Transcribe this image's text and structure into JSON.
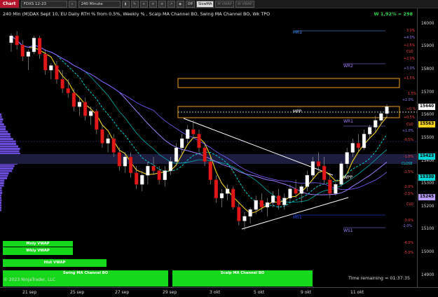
{
  "toolbar": {
    "chart_label": "Chart",
    "instrument": "FDXS 12-23",
    "period": "240 Minute",
    "indicators": [
      {
        "label": "Off",
        "active": false
      },
      {
        "label": "SlowMA",
        "active": true
      },
      {
        "label": "M VWAP",
        "active": false
      },
      {
        "label": "W VWAP",
        "active": false
      }
    ]
  },
  "chart": {
    "title": "240 Min (M)DAX Sept 10, EU Daily RTH % from 0.5%, Weekly % , Scalp MA Channel BO, Swing MA Channel BO, Wk TPO",
    "weekly_stat": "W 1,92% = 298",
    "copyright": "© 2023 NinjaTrader, LLC",
    "time_remaining": "Time remaining = 01:37:35",
    "buttons": {
      "monthly_vwap": "Mnly VWAP",
      "weekly_vwap": "Wkly VWAP",
      "hist_vwap": "Hist VWAP",
      "swing_ma": "Swing MA Channel BO",
      "scalp_ma": "Scalp MA Channel BO"
    },
    "levels": {
      "mr1": "MR1",
      "wr2": "WR2",
      "wr1": "WR1",
      "mpp": "MPP",
      "wpp": "WPP",
      "ws1": "WS1",
      "ms1": "MS1"
    },
    "right_labels": {
      "p30": "3.0%",
      "p40": "+4.0%",
      "p25": "+2.5%",
      "clo1": "CLO",
      "p20": "+2.0%",
      "p15": "+1.5%",
      "p30b": "+3.0%",
      "p15b": "+1.5%",
      "wb1": "1.5%",
      "p20b": "+2.0%",
      "p0": "+0.%",
      "p05": "+0.5%",
      "clo2": "CLO",
      "p10": "+1.0%",
      "m05": "-0.5%",
      "m10": "-1.0%",
      "close": "CLOSE",
      "m15": "-1.5%",
      "m20": "-2.0%",
      "m25": "-2.5%",
      "clo3": "CLO",
      "m30": "-3.0%",
      "m20b": "-2.0%",
      "m40": "-4.0%",
      "m50": "-5.0%"
    },
    "price_axis": [
      "16000",
      "15900",
      "15800",
      "15700",
      "15600",
      "15500",
      "15400",
      "15300",
      "15200",
      "15100",
      "15000",
      "14900"
    ],
    "price_tags": [
      {
        "value": "15640",
        "color": "#ffffff"
      },
      {
        "value": "15563",
        "color": "#f2d21a"
      },
      {
        "value": "15423",
        "color": "#00d4d4"
      },
      {
        "value": "15330",
        "color": "#00d4d4"
      },
      {
        "value": "15245",
        "color": "#b89cff"
      }
    ],
    "time_axis": [
      "21 sep",
      "25 sep",
      "27 sep",
      "29 sep",
      "3 okt",
      "5 okt",
      "9 okt",
      "11 okt"
    ]
  },
  "chart_data": {
    "type": "candlestick",
    "ylim": [
      14850,
      16070
    ],
    "candles": [
      [
        15920,
        15960,
        15880,
        15950
      ],
      [
        15950,
        15970,
        15890,
        15910
      ],
      [
        15910,
        15930,
        15840,
        15860
      ],
      [
        15860,
        15890,
        15800,
        15880
      ],
      [
        15880,
        15950,
        15870,
        15940
      ],
      [
        15940,
        15950,
        15850,
        15870
      ],
      [
        15870,
        15890,
        15780,
        15800
      ],
      [
        15800,
        15830,
        15760,
        15820
      ],
      [
        15820,
        15840,
        15740,
        15760
      ],
      [
        15760,
        15800,
        15700,
        15720
      ],
      [
        15720,
        15760,
        15680,
        15700
      ],
      [
        15700,
        15720,
        15620,
        15640
      ],
      [
        15640,
        15680,
        15600,
        15660
      ],
      [
        15660,
        15680,
        15580,
        15600
      ],
      [
        15600,
        15640,
        15560,
        15620
      ],
      [
        15620,
        15630,
        15520,
        15540
      ],
      [
        15540,
        15560,
        15460,
        15480
      ],
      [
        15480,
        15520,
        15440,
        15500
      ],
      [
        15500,
        15520,
        15420,
        15440
      ],
      [
        15440,
        15460,
        15360,
        15380
      ],
      [
        15380,
        15440,
        15350,
        15420
      ],
      [
        15420,
        15440,
        15330,
        15350
      ],
      [
        15350,
        15380,
        15280,
        15300
      ],
      [
        15300,
        15360,
        15270,
        15340
      ],
      [
        15340,
        15400,
        15300,
        15380
      ],
      [
        15380,
        15420,
        15340,
        15360
      ],
      [
        15360,
        15380,
        15300,
        15320
      ],
      [
        15320,
        15380,
        15290,
        15360
      ],
      [
        15360,
        15420,
        15340,
        15400
      ],
      [
        15400,
        15480,
        15380,
        15460
      ],
      [
        15460,
        15520,
        15430,
        15500
      ],
      [
        15500,
        15560,
        15480,
        15540
      ],
      [
        15540,
        15580,
        15500,
        15520
      ],
      [
        15520,
        15540,
        15440,
        15460
      ],
      [
        15460,
        15480,
        15380,
        15400
      ],
      [
        15400,
        15420,
        15300,
        15320
      ],
      [
        15320,
        15340,
        15220,
        15240
      ],
      [
        15240,
        15280,
        15200,
        15260
      ],
      [
        15260,
        15300,
        15230,
        15280
      ],
      [
        15280,
        15290,
        15190,
        15200
      ],
      [
        15200,
        15220,
        15120,
        15140
      ],
      [
        15140,
        15180,
        15100,
        15160
      ],
      [
        15160,
        15200,
        15130,
        15190
      ],
      [
        15190,
        15250,
        15170,
        15230
      ],
      [
        15230,
        15260,
        15180,
        15200
      ],
      [
        15200,
        15240,
        15160,
        15220
      ],
      [
        15220,
        15270,
        15200,
        15250
      ],
      [
        15250,
        15280,
        15190,
        15210
      ],
      [
        15210,
        15260,
        15190,
        15240
      ],
      [
        15240,
        15300,
        15220,
        15280
      ],
      [
        15280,
        15320,
        15240,
        15260
      ],
      [
        15260,
        15300,
        15220,
        15290
      ],
      [
        15290,
        15360,
        15270,
        15340
      ],
      [
        15340,
        15420,
        15320,
        15400
      ],
      [
        15400,
        15440,
        15360,
        15380
      ],
      [
        15380,
        15420,
        15300,
        15320
      ],
      [
        15320,
        15340,
        15240,
        15260
      ],
      [
        15260,
        15310,
        15250,
        15300
      ],
      [
        15300,
        15400,
        15290,
        15390
      ],
      [
        15390,
        15460,
        15370,
        15440
      ],
      [
        15440,
        15500,
        15420,
        15480
      ],
      [
        15480,
        15520,
        15440,
        15460
      ],
      [
        15460,
        15540,
        15450,
        15520
      ],
      [
        15520,
        15560,
        15500,
        15550
      ],
      [
        15550,
        15600,
        15530,
        15580
      ],
      [
        15580,
        15620,
        15560,
        15610
      ],
      [
        15610,
        15650,
        15590,
        15640
      ]
    ]
  }
}
